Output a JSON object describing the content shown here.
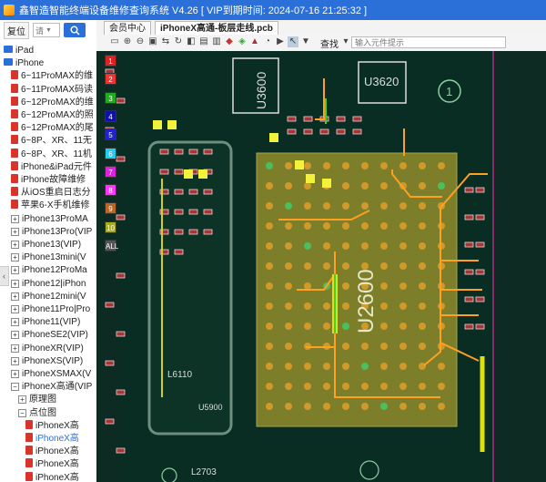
{
  "app": {
    "title": "鑫智造智能终端设备维修查询系统 V4.26 [ VIP到期时间: 2024-07-16 21:25:32 ]"
  },
  "left_panel": {
    "reset_label": "复位",
    "select_value": "请",
    "tree": [
      {
        "type": "folder",
        "label": "iPad",
        "indent": 0
      },
      {
        "type": "folder",
        "label": "iPhone",
        "indent": 0
      },
      {
        "type": "pdf",
        "label": "6~11ProMAX的维",
        "indent": 1
      },
      {
        "type": "pdf",
        "label": "6~11ProMAX码读",
        "indent": 1
      },
      {
        "type": "pdf",
        "label": "6~12ProMAX的维",
        "indent": 1
      },
      {
        "type": "pdf",
        "label": "6~12ProMAX的照",
        "indent": 1
      },
      {
        "type": "pdf",
        "label": "6~12ProMAX的尾",
        "indent": 1
      },
      {
        "type": "pdf",
        "label": "6~8P、XR、11无",
        "indent": 1
      },
      {
        "type": "pdf",
        "label": "6~8P、XR、11机",
        "indent": 1
      },
      {
        "type": "pdf",
        "label": "iPhone&iPad元件",
        "indent": 1
      },
      {
        "type": "pdf",
        "label": "iPhone故障维修",
        "indent": 1
      },
      {
        "type": "pdf",
        "label": "从iOS重启日志分",
        "indent": 1
      },
      {
        "type": "pdf",
        "label": "苹果6-X手机维修",
        "indent": 1
      },
      {
        "type": "plus",
        "label": "iPhone13ProMA",
        "indent": 1
      },
      {
        "type": "plus",
        "label": "iPhone13Pro(VIP",
        "indent": 1
      },
      {
        "type": "plus",
        "label": "iPhone13(VIP)",
        "indent": 1
      },
      {
        "type": "plus",
        "label": "iPhone13mini(V",
        "indent": 1
      },
      {
        "type": "plus",
        "label": "iPhone12ProMa",
        "indent": 1
      },
      {
        "type": "plus",
        "label": "iPhone12|iPhon",
        "indent": 1
      },
      {
        "type": "plus",
        "label": "iPhone12mini(V",
        "indent": 1
      },
      {
        "type": "plus",
        "label": "iPhone11Pro|Pro",
        "indent": 1
      },
      {
        "type": "plus",
        "label": "iPhone11(VIP)",
        "indent": 1
      },
      {
        "type": "plus",
        "label": "iPhoneSE2(VIP)",
        "indent": 1
      },
      {
        "type": "plus",
        "label": "iPhoneXR(VIP)",
        "indent": 1
      },
      {
        "type": "plus",
        "label": "iPhoneXS(VIP)",
        "indent": 1
      },
      {
        "type": "plus",
        "label": "iPhoneXSMAX(V",
        "indent": 1
      },
      {
        "type": "minus",
        "label": "iPhoneX高通(VIP",
        "indent": 1
      },
      {
        "type": "plus",
        "label": "原理图",
        "indent": 2
      },
      {
        "type": "minus",
        "label": "点位图",
        "indent": 2
      },
      {
        "type": "pdf",
        "label": "iPhoneX高",
        "indent": 3
      },
      {
        "type": "pdf",
        "label": "iPhoneX高",
        "indent": 3,
        "selected": true
      },
      {
        "type": "pdf",
        "label": "iPhoneX高",
        "indent": 3
      },
      {
        "type": "pdf",
        "label": "iPhoneX高",
        "indent": 3
      },
      {
        "type": "pdf",
        "label": "iPhoneX高",
        "indent": 3
      }
    ]
  },
  "tabs": [
    {
      "label": "会员中心",
      "active": false
    },
    {
      "label": "iPhoneX高通-板层走线.pcb",
      "active": true
    }
  ],
  "toolbar": {
    "search_label": "查找",
    "search_placeholder": "输入元件提示"
  },
  "layers": [
    {
      "label": "1",
      "color": "#d22"
    },
    {
      "label": "2",
      "color": "#e33"
    },
    {
      "label": "3",
      "color": "#2a2"
    },
    {
      "label": "4",
      "color": "#11a"
    },
    {
      "label": "5",
      "color": "#22c"
    },
    {
      "label": "6",
      "color": "#2ce"
    },
    {
      "label": "7",
      "color": "#d2d"
    },
    {
      "label": "8",
      "color": "#f3f"
    },
    {
      "label": "9",
      "color": "#b62"
    },
    {
      "label": "10",
      "color": "#aa2"
    },
    {
      "label": "ALL",
      "color": "#555"
    }
  ],
  "board": {
    "chip_u3600": "U3600",
    "chip_u3620": "U3620",
    "chip_u2600": "U2600",
    "label_l6110": "L6110",
    "label_u5900": "U5900",
    "label_l2703": "L2703",
    "circle_1": "1"
  }
}
